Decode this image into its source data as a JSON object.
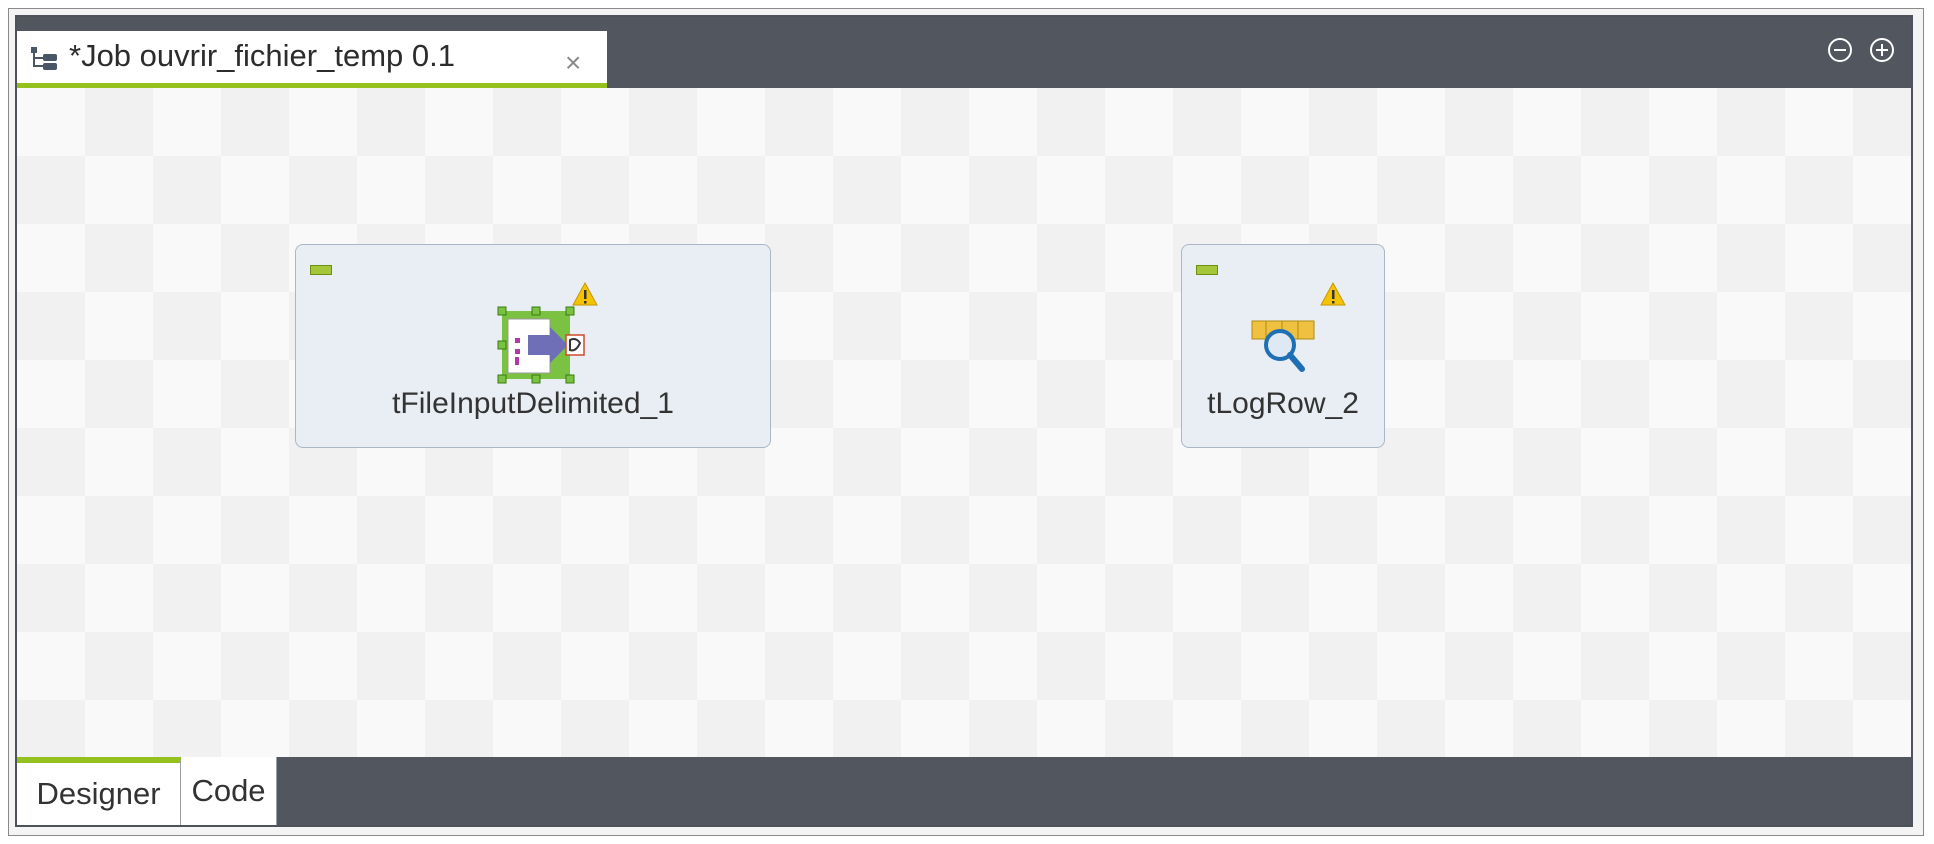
{
  "editor": {
    "tab_title": "*Job ouvrir_fichier_temp 0.1",
    "close_symbol": "×",
    "icons": {
      "job": "job-tree-icon",
      "minimize": "minimize-circle-icon",
      "maximize": "maximize-circle-icon"
    },
    "accent_color": "#95c11f",
    "bar_color": "#52565e"
  },
  "components": [
    {
      "label": "tFileInputDelimited_1",
      "icon": "file-input-delimited-icon",
      "warning": true
    },
    {
      "label": "tLogRow_2",
      "icon": "log-row-icon",
      "warning": true
    }
  ],
  "bottom_tabs": [
    {
      "label": "Designer",
      "active": true
    },
    {
      "label": "Code",
      "active": false
    }
  ]
}
